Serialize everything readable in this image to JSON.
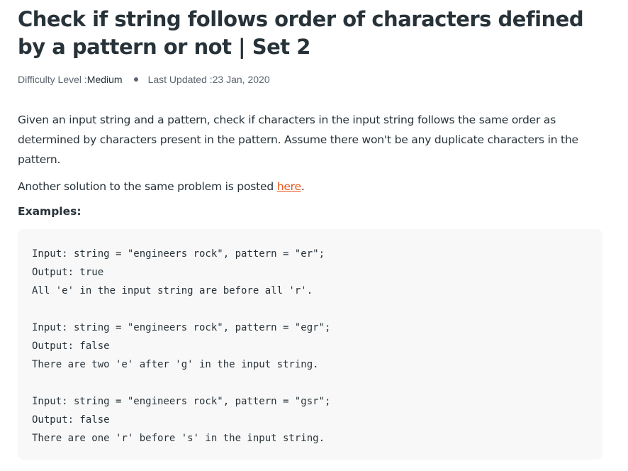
{
  "article": {
    "title": "Check if string follows order of characters defined by a pattern or not | Set 2",
    "meta": {
      "difficulty_label": "Difficulty Level : ",
      "difficulty_value": "Medium",
      "updated_label": "Last Updated : ",
      "updated_value": "23 Jan, 2020"
    },
    "paragraph1": "Given an input string and a pattern, check if characters in the input string follows the same order as determined by characters present in the pattern. Assume there won't be any duplicate characters in the pattern.",
    "paragraph2": {
      "before": "Another solution to the same problem is posted ",
      "link": "here",
      "after": "."
    },
    "examples_label": "Examples:",
    "code_lines": [
      "Input: string = \"engineers rock\", pattern = \"er\";",
      "Output: true",
      "All 'e' in the input string are before all 'r'.",
      "",
      "Input: string = \"engineers rock\", pattern = \"egr\";",
      "Output: false",
      "There are two 'e' after 'g' in the input string.",
      "",
      "Input: string = \"engineers rock\", pattern = \"gsr\";",
      "Output: false",
      "There are one 'r' before 's' in the input string."
    ]
  },
  "colors": {
    "text": "#273239",
    "muted": "#5b6470",
    "link": "#e8581c",
    "code_bg": "#f8f8f8"
  }
}
